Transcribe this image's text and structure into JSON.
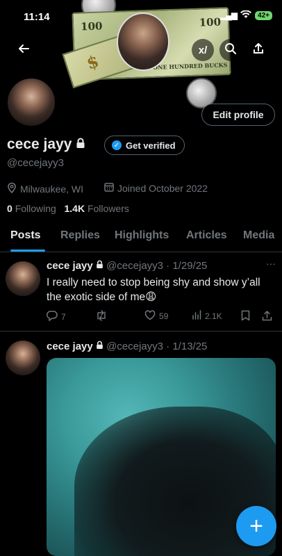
{
  "status_bar": {
    "time": "11:14",
    "battery": "42+"
  },
  "banner": {
    "bill_value_left": "100",
    "bill_value_right": "100",
    "bill_caption": "ONE HUNDRED BUCKS",
    "dollar_sign": "$"
  },
  "header": {
    "back_icon": "arrow-left-icon",
    "grok_icon": "grok-icon",
    "search_icon": "search-icon",
    "share_icon": "share-icon"
  },
  "profile": {
    "edit_label": "Edit profile",
    "name": "cece jayy",
    "verify_label": "Get verified",
    "handle": "@cecejayy3",
    "location": "Milwaukee, WI",
    "joined": "Joined October 2022",
    "following_count": "0",
    "following_label": "Following",
    "followers_count": "1.4K",
    "followers_label": "Followers"
  },
  "tabs": [
    {
      "label": "Posts"
    },
    {
      "label": "Replies"
    },
    {
      "label": "Highlights"
    },
    {
      "label": "Articles"
    },
    {
      "label": "Media"
    }
  ],
  "tweets": [
    {
      "name": "cece jayy",
      "handle_date": "@cecejayy3 · 1/29/25",
      "text": "I really need to stop being shy and show y’all the exotic side of me😩",
      "replies": "7",
      "retweets": "",
      "likes": "59",
      "views": "2.1K"
    },
    {
      "name": "cece jayy",
      "handle_date": "@cecejayy3 · 1/13/25"
    }
  ],
  "fab_label": "+",
  "colors": {
    "accent": "#1d9bf0",
    "background": "#000000",
    "muted": "#71767b"
  }
}
